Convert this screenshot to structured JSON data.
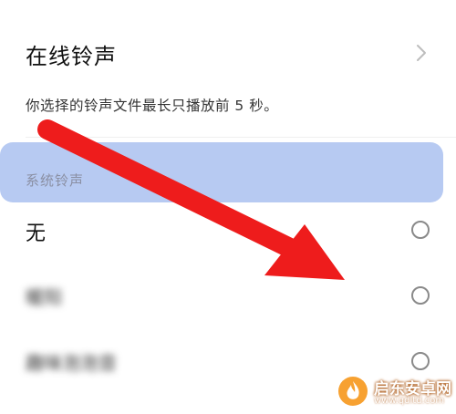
{
  "online_ringtone": {
    "label": "在线铃声",
    "chevron_icon": "chevron-right-icon"
  },
  "hint_text": "你选择的铃声文件最长只播放前 5 秒。",
  "section": {
    "title": "系统铃声",
    "highlight_color": "#b7caf2"
  },
  "options": [
    {
      "label": "无",
      "selected": false
    },
    {
      "label": "暖阳",
      "selected": false
    },
    {
      "label": "趣味泡泡音",
      "selected": false
    }
  ],
  "annotation": {
    "icon": "red-arrow-icon",
    "color": "#ee1c1c"
  },
  "watermark": {
    "name": "启东安卓网",
    "url": "www.qdltd.com",
    "logo_icon": "flame-logo-icon"
  }
}
